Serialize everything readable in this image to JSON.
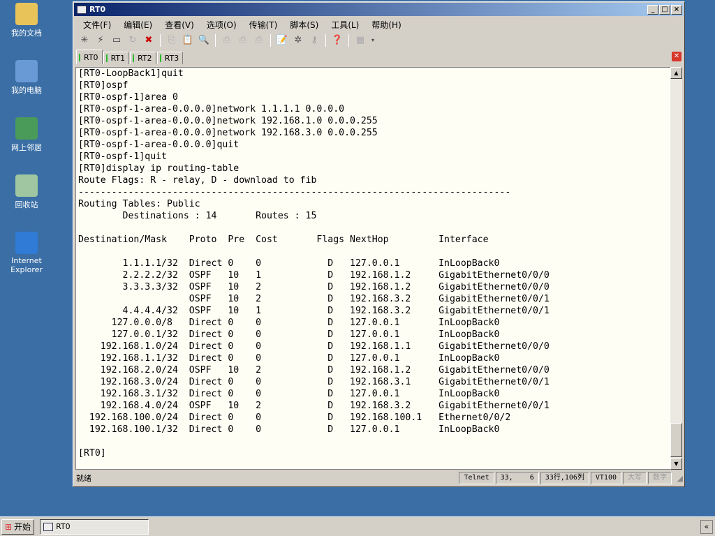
{
  "desktop": [
    {
      "label": "我的文档",
      "color": "#e8c35a"
    },
    {
      "label": "我的电脑",
      "color": "#6a9ad6"
    },
    {
      "label": "网上邻居",
      "color": "#4a9b5a"
    },
    {
      "label": "回收站",
      "color": "#9fc6a0"
    },
    {
      "label": "Internet Explorer",
      "color": "#2f7bd6"
    }
  ],
  "window": {
    "title": "RT0",
    "min": "_",
    "max": "□",
    "close": "×"
  },
  "menu": [
    "文件(F)",
    "编辑(E)",
    "查看(V)",
    "选项(O)",
    "传输(T)",
    "脚本(S)",
    "工具(L)",
    "帮助(H)"
  ],
  "tabs": [
    "RT0",
    "RT1",
    "RT2",
    "RT3"
  ],
  "terminal_lines": [
    "[RT0-LoopBack1]quit",
    "[RT0]ospf",
    "[RT0-ospf-1]area 0",
    "[RT0-ospf-1-area-0.0.0.0]network 1.1.1.1 0.0.0.0",
    "[RT0-ospf-1-area-0.0.0.0]network 192.168.1.0 0.0.0.255",
    "[RT0-ospf-1-area-0.0.0.0]network 192.168.3.0 0.0.0.255",
    "[RT0-ospf-1-area-0.0.0.0]quit",
    "[RT0-ospf-1]quit",
    "[RT0]display ip routing-table",
    "Route Flags: R - relay, D - download to fib",
    "------------------------------------------------------------------------------",
    "Routing Tables: Public",
    "        Destinations : 14       Routes : 15",
    "",
    "Destination/Mask    Proto  Pre  Cost       Flags NextHop         Interface",
    "",
    "        1.1.1.1/32  Direct 0    0            D   127.0.0.1       InLoopBack0",
    "        2.2.2.2/32  OSPF   10   1            D   192.168.1.2     GigabitEthernet0/0/0",
    "        3.3.3.3/32  OSPF   10   2            D   192.168.1.2     GigabitEthernet0/0/0",
    "                    OSPF   10   2            D   192.168.3.2     GigabitEthernet0/0/1",
    "        4.4.4.4/32  OSPF   10   1            D   192.168.3.2     GigabitEthernet0/0/1",
    "      127.0.0.0/8   Direct 0    0            D   127.0.0.1       InLoopBack0",
    "      127.0.0.1/32  Direct 0    0            D   127.0.0.1       InLoopBack0",
    "    192.168.1.0/24  Direct 0    0            D   192.168.1.1     GigabitEthernet0/0/0",
    "    192.168.1.1/32  Direct 0    0            D   127.0.0.1       InLoopBack0",
    "    192.168.2.0/24  OSPF   10   2            D   192.168.1.2     GigabitEthernet0/0/0",
    "    192.168.3.0/24  Direct 0    0            D   192.168.3.1     GigabitEthernet0/0/1",
    "    192.168.3.1/32  Direct 0    0            D   127.0.0.1       InLoopBack0",
    "    192.168.4.0/24  OSPF   10   2            D   192.168.3.2     GigabitEthernet0/0/1",
    "  192.168.100.0/24  Direct 0    0            D   192.168.100.1   Ethernet0/0/2",
    "  192.168.100.1/32  Direct 0    0            D   127.0.0.1       InLoopBack0",
    "",
    "[RT0]"
  ],
  "status": {
    "ready": "就绪",
    "protocol": "Telnet",
    "cursor": "33,    6",
    "rowcol": "33行,106列",
    "emulation": "VT100",
    "caps": "大写",
    "num": "数字"
  },
  "taskbar": {
    "start": "开始",
    "task": "RT0",
    "tray": "«"
  }
}
